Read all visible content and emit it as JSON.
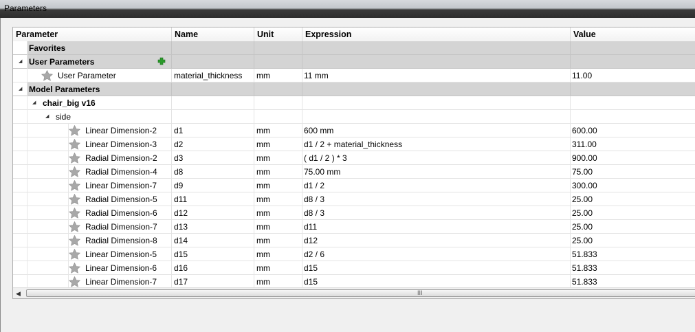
{
  "window": {
    "title": "Parameters"
  },
  "columns": {
    "parameter": "Parameter",
    "name": "Name",
    "unit": "Unit",
    "expression": "Expression",
    "value": "Value"
  },
  "groups": {
    "favorites": "Favorites",
    "user_parameters": "User Parameters",
    "model_parameters": "Model Parameters",
    "component": "chair_big v16",
    "sketch": "side"
  },
  "user_param": {
    "label": "User Parameter",
    "name": "material_thickness",
    "unit": "mm",
    "expression": "11 mm",
    "value": "11.00"
  },
  "rows": [
    {
      "label": "Linear Dimension-2",
      "name": "d1",
      "unit": "mm",
      "expression": "600 mm",
      "value": "600.00"
    },
    {
      "label": "Linear Dimension-3",
      "name": "d2",
      "unit": "mm",
      "expression": "d1 / 2 + material_thickness",
      "value": "311.00"
    },
    {
      "label": "Radial Dimension-2",
      "name": "d3",
      "unit": "mm",
      "expression": "( d1 / 2 ) * 3",
      "value": "900.00"
    },
    {
      "label": "Radial Dimension-4",
      "name": "d8",
      "unit": "mm",
      "expression": "75.00 mm",
      "value": "75.00"
    },
    {
      "label": "Linear Dimension-7",
      "name": "d9",
      "unit": "mm",
      "expression": "d1 / 2",
      "value": "300.00"
    },
    {
      "label": "Radial Dimension-5",
      "name": "d11",
      "unit": "mm",
      "expression": "d8 / 3",
      "value": "25.00"
    },
    {
      "label": "Radial Dimension-6",
      "name": "d12",
      "unit": "mm",
      "expression": "d8 / 3",
      "value": "25.00"
    },
    {
      "label": "Radial Dimension-7",
      "name": "d13",
      "unit": "mm",
      "expression": "d11",
      "value": "25.00"
    },
    {
      "label": "Radial Dimension-8",
      "name": "d14",
      "unit": "mm",
      "expression": "d12",
      "value": "25.00"
    },
    {
      "label": "Linear Dimension-5",
      "name": "d15",
      "unit": "mm",
      "expression": "d2 / 6",
      "value": "51.833"
    },
    {
      "label": "Linear Dimension-6",
      "name": "d16",
      "unit": "mm",
      "expression": "d15",
      "value": "51.833"
    },
    {
      "label": "Linear Dimension-7",
      "name": "d17",
      "unit": "mm",
      "expression": "d15",
      "value": "51.833"
    }
  ],
  "icons": {
    "favorite": "star-icon",
    "add": "plus-icon",
    "expand": "triangle-expanded-icon",
    "colors": {
      "star": "#9a9a9a",
      "plus": "#2a9a2a",
      "group_bg": "#d4d4d4"
    }
  },
  "scrollbar": {
    "grip": "III"
  }
}
